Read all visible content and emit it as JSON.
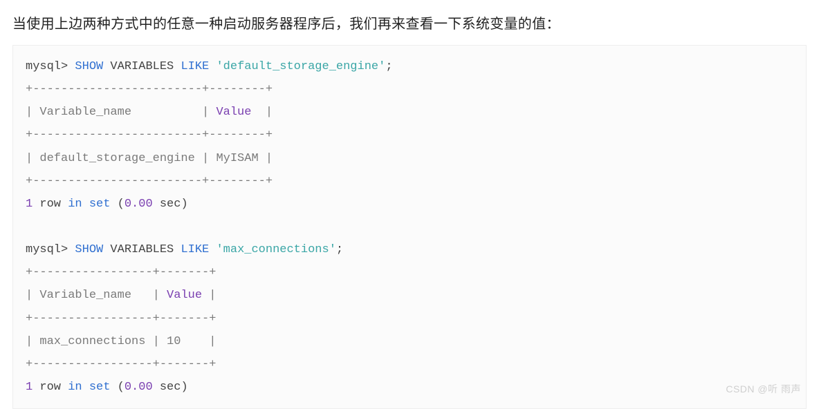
{
  "intro": "当使用上边两种方式中的任意一种启动服务器程序后，我们再来查看一下系统变量的值：",
  "code": {
    "q1_prompt": "mysql> ",
    "q1_show": "SHOW",
    "q1_vars": " VARIABLES ",
    "q1_like": "LIKE",
    "q1_sp": " ",
    "q1_str": "'default_storage_engine'",
    "q1_semi": ";",
    "t1_border": "+------------------------+--------+",
    "t1_hdr_a": "| Variable_name          | ",
    "t1_hdr_val": "Value",
    "t1_hdr_b": "  |",
    "t1_row": "| default_storage_engine | MyISAM |",
    "r1_a": "1",
    "r1_b": " row ",
    "r1_in": "in",
    "r1_c": " ",
    "r1_set": "set",
    "r1_d": " (",
    "r1_e": "0.00",
    "r1_f": " sec)",
    "blank": "",
    "q2_prompt": "mysql> ",
    "q2_show": "SHOW",
    "q2_vars": " VARIABLES ",
    "q2_like": "LIKE",
    "q2_sp": " ",
    "q2_str": "'max_connections'",
    "q2_semi": ";",
    "t2_border": "+-----------------+-------+",
    "t2_hdr_a": "| Variable_name   | ",
    "t2_hdr_val": "Value",
    "t2_hdr_b": " |",
    "t2_row": "| max_connections | 10    |",
    "r2_a": "1",
    "r2_b": " row ",
    "r2_in": "in",
    "r2_c": " ",
    "r2_set": "set",
    "r2_d": " (",
    "r2_e": "0.00",
    "r2_f": " sec)"
  },
  "watermark": "CSDN @听 雨声"
}
